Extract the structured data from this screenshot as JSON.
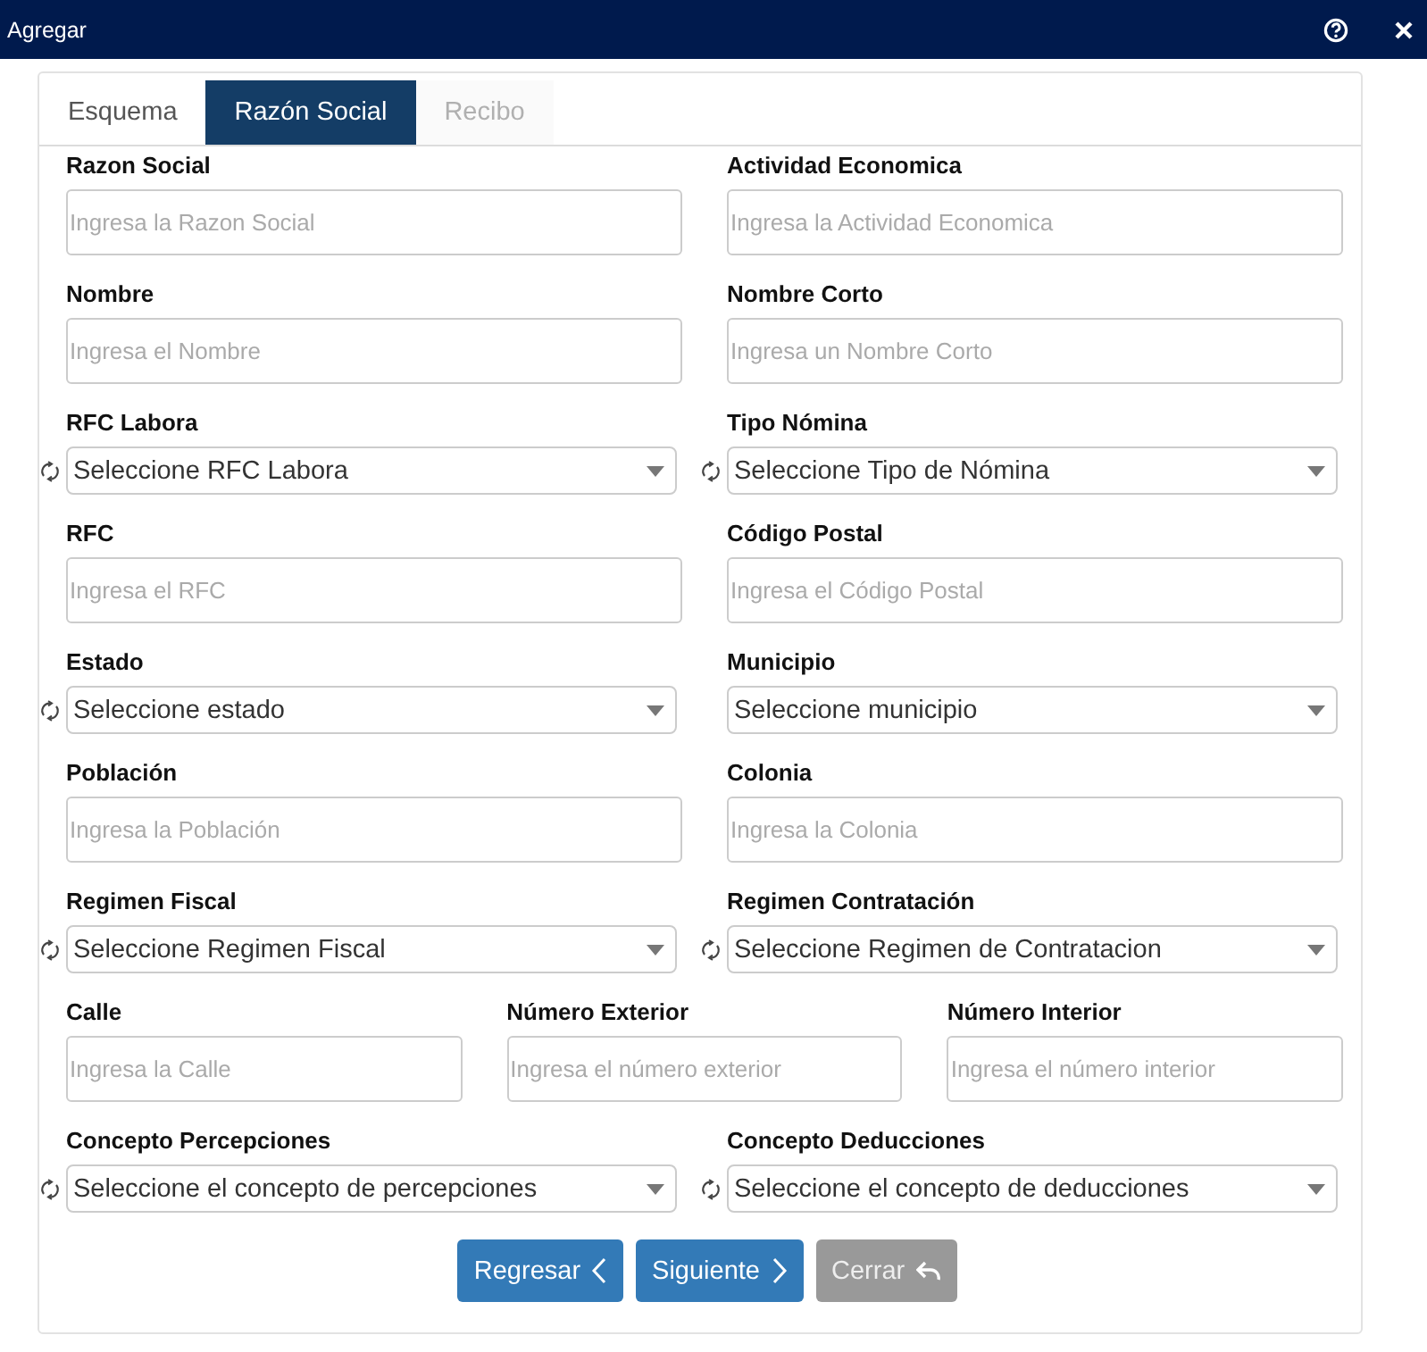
{
  "window": {
    "title": "Agregar"
  },
  "tabs": [
    {
      "label": "Esquema",
      "selected": false,
      "disabled": false
    },
    {
      "label": "Razón Social",
      "selected": true,
      "disabled": false
    },
    {
      "label": "Recibo",
      "selected": false,
      "disabled": true
    }
  ],
  "rows": [
    {
      "fields": [
        {
          "label": "Razon Social",
          "kind": "input",
          "placeholder": "Ingresa la Razon Social"
        },
        {
          "label": "Actividad Economica",
          "kind": "input",
          "placeholder": "Ingresa la Actividad Economica"
        }
      ]
    },
    {
      "fields": [
        {
          "label": "Nombre",
          "kind": "input",
          "placeholder": "Ingresa el Nombre"
        },
        {
          "label": "Nombre Corto",
          "kind": "input",
          "placeholder": "Ingresa un Nombre Corto"
        }
      ]
    },
    {
      "fields": [
        {
          "label": "RFC Labora",
          "kind": "select",
          "value": "Seleccione RFC Labora",
          "refresh": true
        },
        {
          "label": "Tipo Nómina",
          "kind": "select",
          "value": "Seleccione Tipo de Nómina",
          "refresh": true
        }
      ]
    },
    {
      "fields": [
        {
          "label": "RFC",
          "kind": "input",
          "placeholder": "Ingresa el RFC"
        },
        {
          "label": "Código Postal",
          "kind": "input",
          "placeholder": "Ingresa el Código Postal"
        }
      ]
    },
    {
      "fields": [
        {
          "label": "Estado",
          "kind": "select",
          "value": "Seleccione estado",
          "refresh": true
        },
        {
          "label": "Municipio",
          "kind": "select",
          "value": "Seleccione municipio",
          "refresh": false
        }
      ]
    },
    {
      "fields": [
        {
          "label": "Población",
          "kind": "input",
          "placeholder": "Ingresa la Población"
        },
        {
          "label": "Colonia",
          "kind": "input",
          "placeholder": "Ingresa la Colonia"
        }
      ]
    },
    {
      "fields": [
        {
          "label": "Regimen Fiscal",
          "kind": "select",
          "value": "Seleccione Regimen Fiscal",
          "refresh": true
        },
        {
          "label": "Regimen Contratación",
          "kind": "select",
          "value": "Seleccione Regimen de Contratacion",
          "refresh": true
        }
      ]
    },
    {
      "fields": [
        {
          "label": "Calle",
          "kind": "input",
          "placeholder": "Ingresa la Calle"
        },
        {
          "label": "Número Exterior",
          "kind": "input",
          "placeholder": "Ingresa el número exterior"
        },
        {
          "label": "Número Interior",
          "kind": "input",
          "placeholder": "Ingresa el número interior"
        }
      ]
    },
    {
      "fields": [
        {
          "label": "Concepto Percepciones",
          "kind": "select",
          "value": "Seleccione el concepto de percepciones",
          "refresh": true
        },
        {
          "label": "Concepto Deducciones",
          "kind": "select",
          "value": "Seleccione el concepto de deducciones",
          "refresh": true
        }
      ]
    }
  ],
  "buttons": [
    {
      "label": "Regresar",
      "kind": "back",
      "disabled": false
    },
    {
      "label": "Siguiente",
      "kind": "next",
      "disabled": false
    },
    {
      "label": "Cerrar",
      "kind": "close",
      "disabled": true
    }
  ]
}
